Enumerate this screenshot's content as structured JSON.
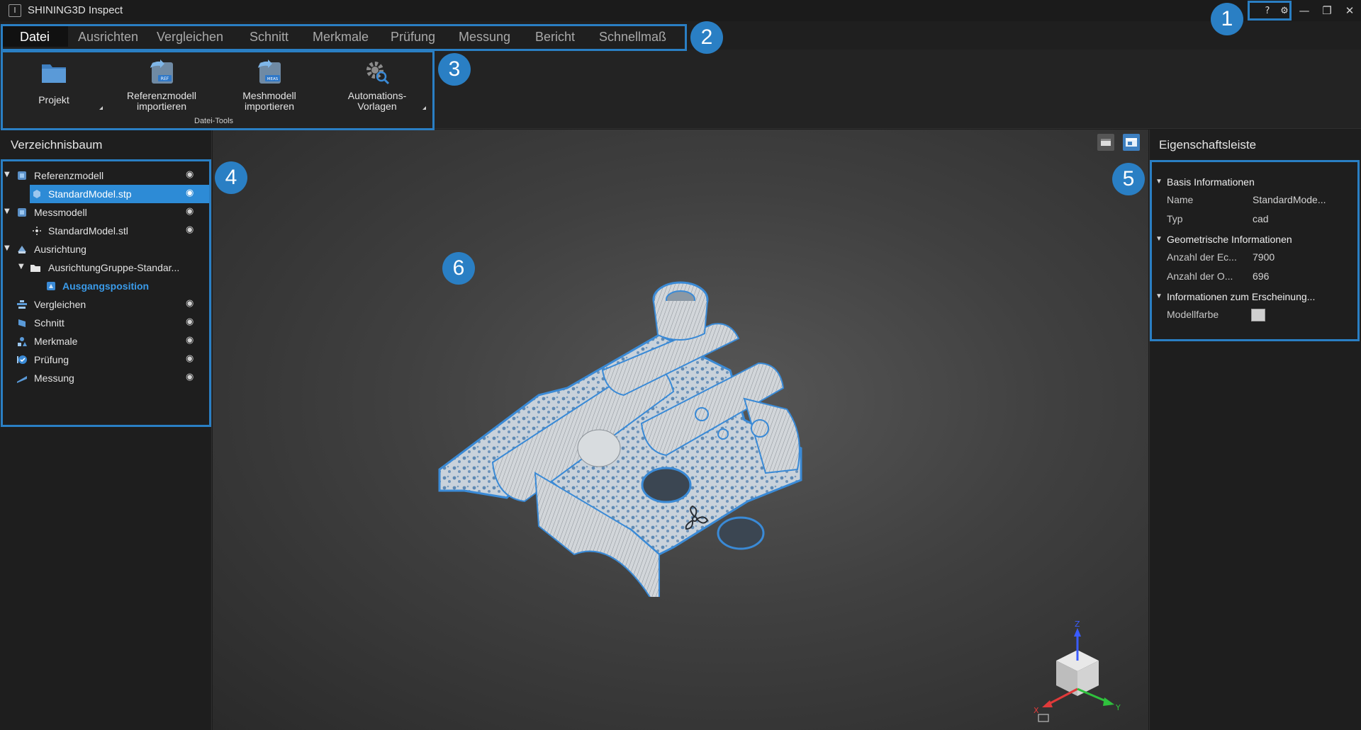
{
  "app": {
    "logo_glyph": "I",
    "title": "SHINING3D Inspect"
  },
  "window_controls": {
    "help_glyph": "?",
    "settings_glyph": "⚙",
    "minimize_glyph": "—",
    "restore_glyph": "❐",
    "close_glyph": "✕"
  },
  "menu": {
    "tabs": [
      "Datei",
      "Ausrichten",
      "Vergleichen",
      "Schnitt",
      "Merkmale",
      "Prüfung",
      "Messung",
      "Bericht",
      "Schnellmaß"
    ],
    "active": "Datei"
  },
  "ribbon": {
    "buttons": [
      {
        "line1": "Projekt",
        "line2": ""
      },
      {
        "line1": "Referenzmodell",
        "line2": "importieren",
        "tag": "REF"
      },
      {
        "line1": "Meshmodell",
        "line2": "importieren",
        "tag": "MEAS"
      },
      {
        "line1": "Automations-",
        "line2": "Vorlagen"
      }
    ],
    "group_label": "Datei-Tools"
  },
  "left_panel": {
    "title": "Verzeichnisbaum",
    "tree": [
      {
        "label": "Referenzmodell",
        "eye": true,
        "arrow": "▼"
      },
      {
        "label": "StandardModel.stp",
        "eye": true,
        "arrow": ""
      },
      {
        "label": "Messmodell",
        "eye": true,
        "arrow": "▼"
      },
      {
        "label": "StandardModel.stl",
        "eye": true,
        "arrow": ""
      },
      {
        "label": "Ausrichtung",
        "eye": false,
        "arrow": "▼"
      },
      {
        "label": "AusrichtungGruppe-Standar...",
        "eye": false,
        "arrow": "▼"
      },
      {
        "label": "Ausgangsposition",
        "eye": false,
        "arrow": ""
      },
      {
        "label": "Vergleichen",
        "eye": true,
        "arrow": ""
      },
      {
        "label": "Schnitt",
        "eye": true,
        "arrow": ""
      },
      {
        "label": "Merkmale",
        "eye": true,
        "arrow": ""
      },
      {
        "label": "Prüfung",
        "eye": true,
        "arrow": ""
      },
      {
        "label": "Messung",
        "eye": true,
        "arrow": ""
      }
    ],
    "eye_glyph": "◉"
  },
  "right_panel": {
    "title": "Eigenschaftsleiste",
    "sections": [
      {
        "title": "Basis Informationen",
        "rows": [
          {
            "key": "Name",
            "value": "StandardMode..."
          },
          {
            "key": "Typ",
            "value": "cad"
          }
        ]
      },
      {
        "title": "Geometrische Informationen",
        "rows": [
          {
            "key": "Anzahl der Ec...",
            "value": "7900"
          },
          {
            "key": "Anzahl der O...",
            "value": "696"
          }
        ]
      },
      {
        "title": "Informationen zum Erscheinung...",
        "rows": [
          {
            "key": "Modellfarbe",
            "value": ""
          }
        ]
      }
    ],
    "section_arrow": "▼"
  },
  "axes": {
    "x": "X",
    "y": "Y",
    "z": "Z"
  },
  "callouts": [
    "1",
    "2",
    "3",
    "4",
    "5",
    "6"
  ],
  "colors": {
    "accent": "#2a7fc4",
    "selection": "#2d8bd6",
    "link_bold": "#3a9bea"
  }
}
